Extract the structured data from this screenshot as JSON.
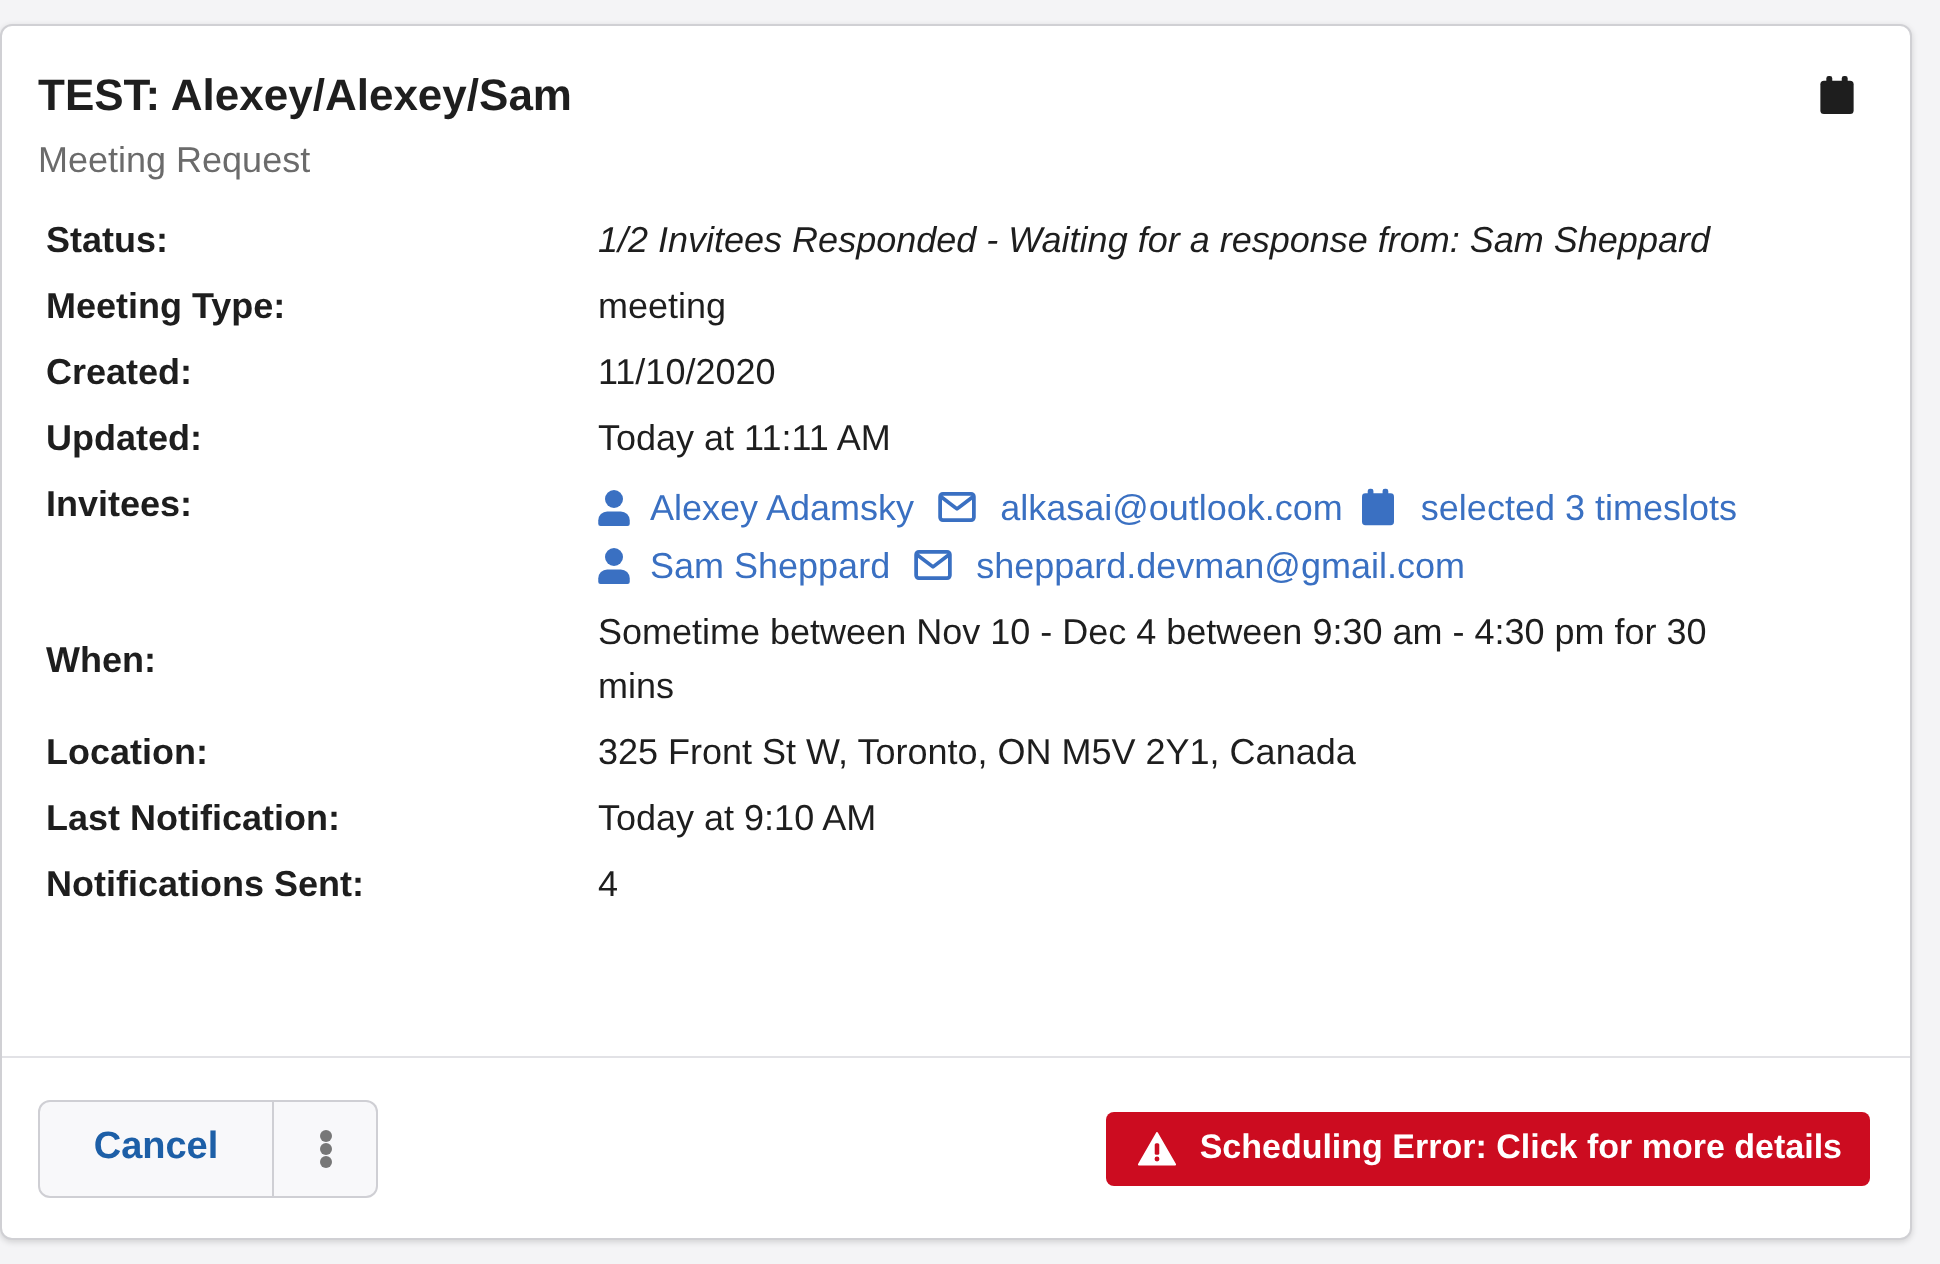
{
  "header": {
    "title": "TEST: Alexey/Alexey/Sam",
    "subtitle": "Meeting Request"
  },
  "details": [
    {
      "kind": "status",
      "label": "Status:",
      "value": "1/2 Invitees Responded - Waiting for a response from: Sam Sheppard"
    },
    {
      "kind": "text",
      "label": "Meeting Type:",
      "value": "meeting"
    },
    {
      "kind": "text",
      "label": "Created:",
      "value": "11/10/2020"
    },
    {
      "kind": "text",
      "label": "Updated:",
      "value": "Today at 11:11 AM"
    },
    {
      "kind": "invitees",
      "label": "Invitees:",
      "invitees": [
        {
          "name": "Alexey Adamsky",
          "email": "alkasai@outlook.com",
          "timeslots": "selected 3 timeslots"
        },
        {
          "name": "Sam Sheppard",
          "email": "sheppard.devman@gmail.com"
        }
      ]
    },
    {
      "kind": "text",
      "label": "When:",
      "value": "Sometime between Nov 10 - Dec 4 between 9:30 am - 4:30 pm for 30 mins"
    },
    {
      "kind": "text",
      "label": "Location:",
      "value": "325 Front St W, Toronto, ON M5V 2Y1, Canada"
    },
    {
      "kind": "text",
      "label": "Last Notification:",
      "value": "Today at 9:10 AM"
    },
    {
      "kind": "text",
      "label": "Notifications Sent:",
      "value": "4"
    }
  ],
  "footer": {
    "cancel_button": "Cancel",
    "error_button": "Scheduling Error: Click for more details"
  }
}
